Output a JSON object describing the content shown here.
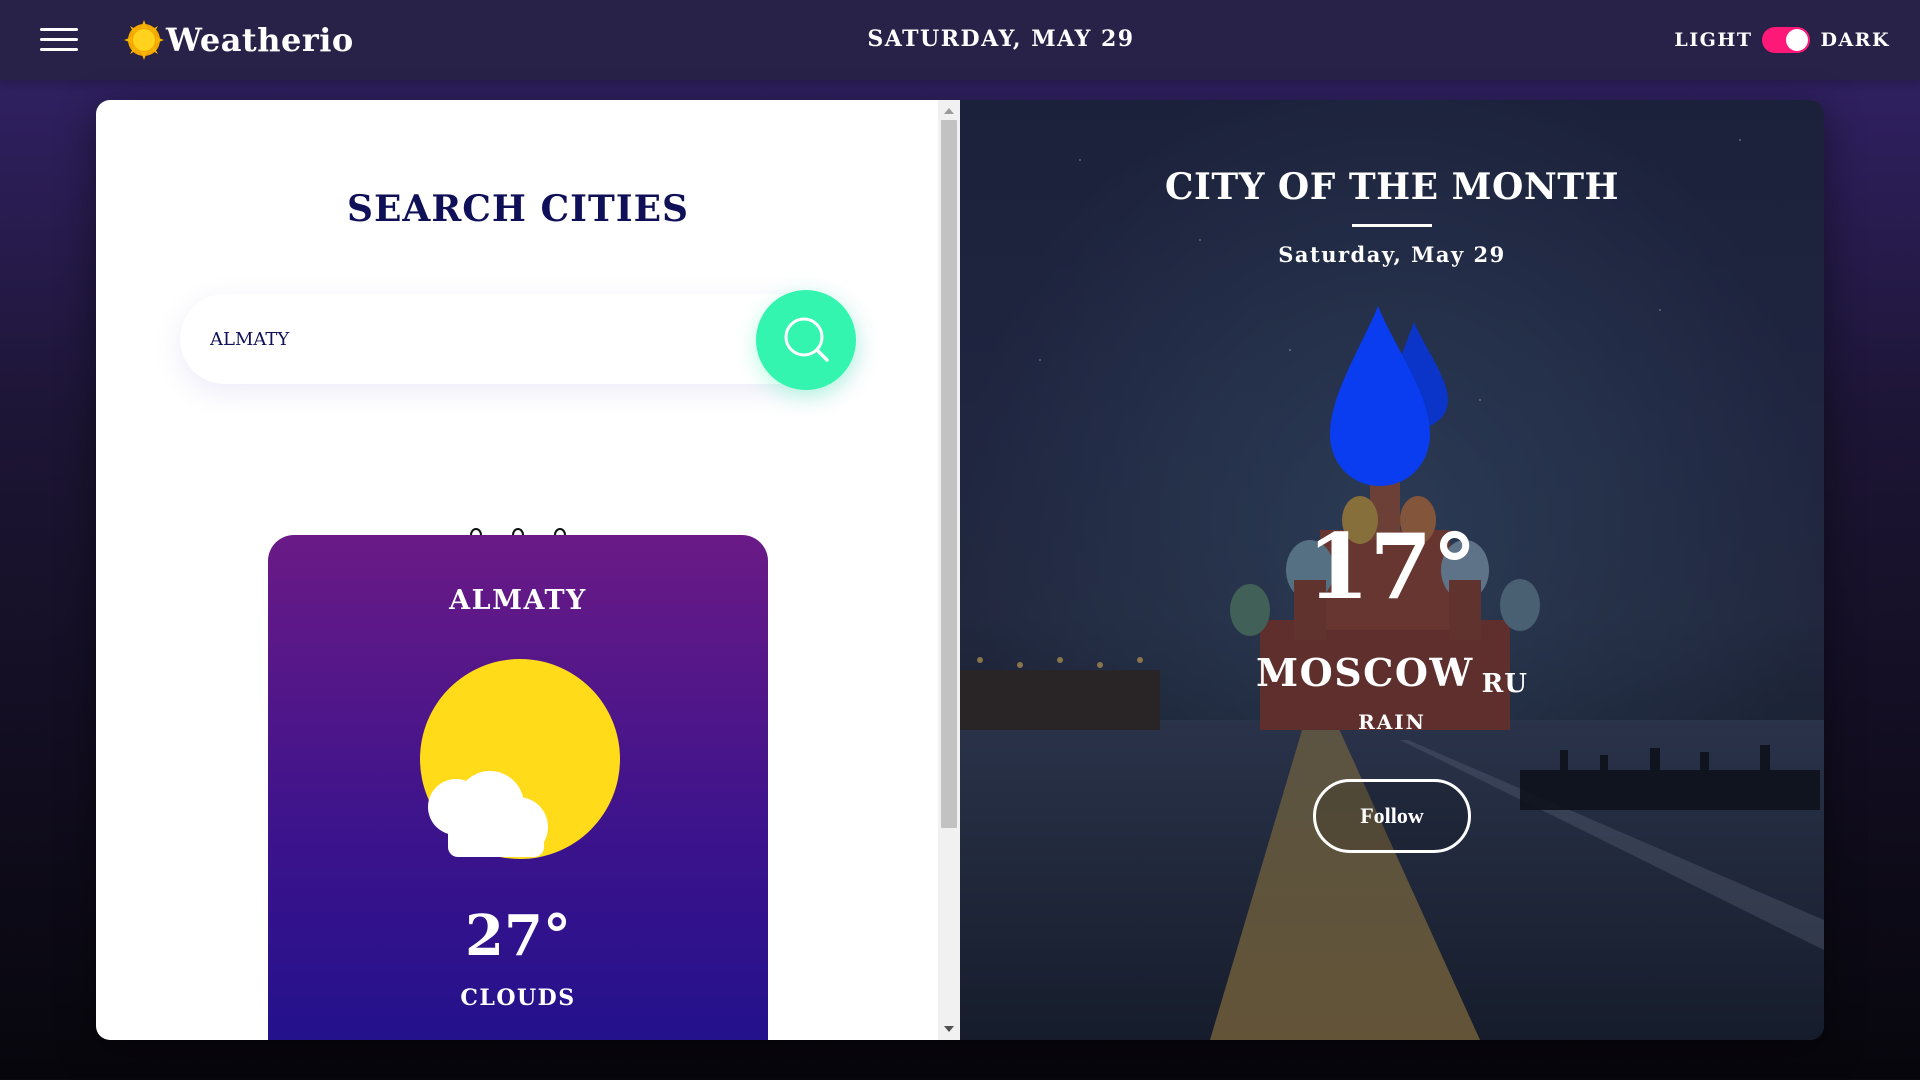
{
  "header": {
    "brand_name": "Weatherio",
    "date": "SATURDAY, MAY 29",
    "theme_light_label": "LIGHT",
    "theme_dark_label": "DARK",
    "theme_toggle_color": "#ff1a7a"
  },
  "search": {
    "title": "SEARCH CITIES",
    "query": "ALMATY",
    "button_icon": "search-icon",
    "button_color": "#33f5b0",
    "pager_dots": 3
  },
  "city_card": {
    "name": "ALMATY",
    "icon": "sun-behind-cloud-icon",
    "temperature": "27°",
    "condition": "CLOUDS"
  },
  "city_of_month": {
    "title": "CITY OF THE MONTH",
    "date": "Saturday, May 29",
    "icon": "rain-drops-icon",
    "temperature": "17°",
    "city": "MOSCOW",
    "country": "RU",
    "condition": "RAIN",
    "follow_label": "Follow"
  },
  "colors": {
    "header_bg": "#282249",
    "title_navy": "#101058",
    "card_gradient_top": "#6a1a86",
    "card_gradient_bottom": "#22118c",
    "rain_blue": "#0a3cf0"
  }
}
